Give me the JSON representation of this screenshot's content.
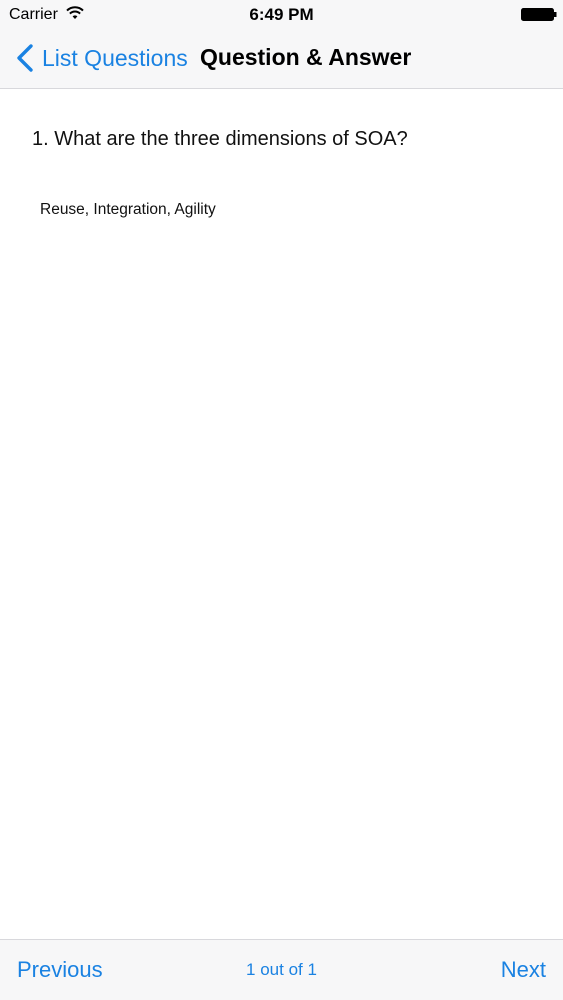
{
  "status_bar": {
    "carrier": "Carrier",
    "time": "6:49 PM",
    "wifi_icon": "wifi-icon",
    "battery_icon": "battery-full-icon"
  },
  "nav_bar": {
    "back_label": "List Questions",
    "back_icon": "chevron-left-icon",
    "title": "Question & Answer"
  },
  "content": {
    "question": "1. What are the three dimensions of SOA?",
    "answer": "Reuse, Integration, Agility"
  },
  "bottom_bar": {
    "previous_label": "Previous",
    "page_counter": "1 out of 1",
    "next_label": "Next"
  },
  "colors": {
    "accent": "#1a82e2",
    "bar_background": "#f7f7f8",
    "text": "#111111"
  }
}
